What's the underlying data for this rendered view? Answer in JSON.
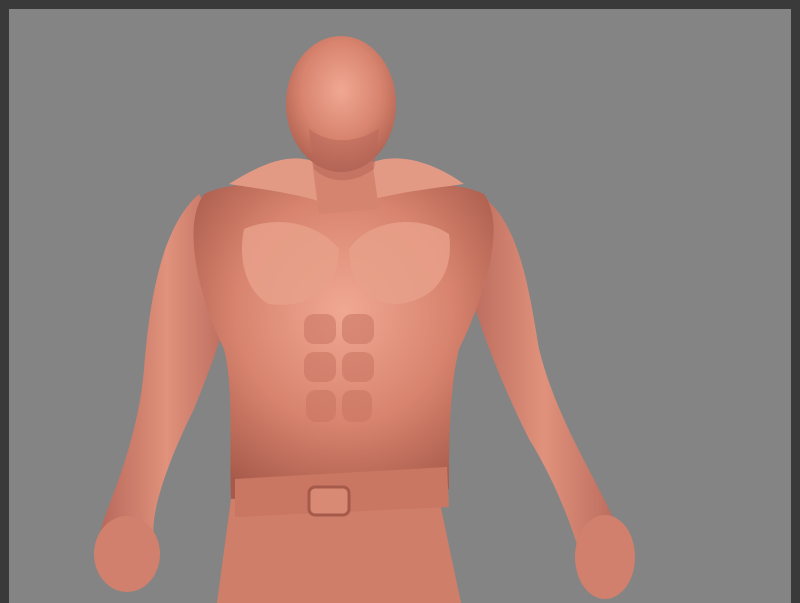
{
  "scene": {
    "subject": "sculpted-muscular-torso-render",
    "colors": {
      "background": "#848484",
      "frame": "#3a3a3a",
      "skin": "#d8846f",
      "skin_highlight": "#f0a893",
      "skin_shadow": "#a85a4a"
    }
  }
}
